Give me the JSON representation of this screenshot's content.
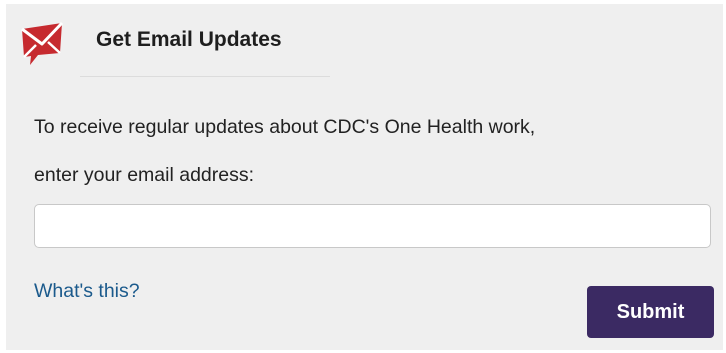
{
  "header": {
    "icon": "envelope-icon",
    "title": "Get Email Updates"
  },
  "description": {
    "line1": "To receive regular updates about CDC's One Health work,",
    "line2": "enter your email address:"
  },
  "email_field": {
    "value": "",
    "placeholder": ""
  },
  "links": {
    "whats_this": "What's this?"
  },
  "buttons": {
    "submit": "Submit"
  },
  "colors": {
    "panel_background": "#efefef",
    "icon_red": "#c62a2f",
    "link_blue": "#1b5a8c",
    "submit_purple": "#3b2a63"
  }
}
